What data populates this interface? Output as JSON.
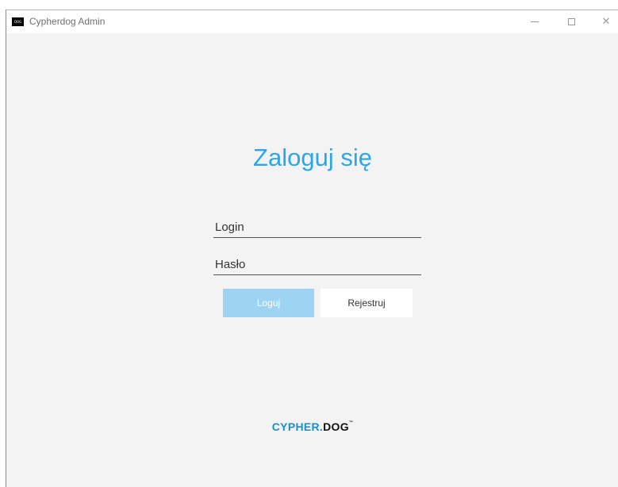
{
  "window": {
    "title": "Cypherdog Admin",
    "icon_label": "DOG",
    "controls": {
      "minimize_icon": "minimize-icon",
      "maximize_icon": "maximize-icon",
      "close_icon": "close-icon",
      "close_glyph": "✕"
    }
  },
  "login_form": {
    "heading": "Zaloguj się",
    "login_placeholder": "Login",
    "password_placeholder": "Hasło",
    "login_button": "Loguj",
    "register_button": "Rejestruj"
  },
  "brand": {
    "part1": "CYPHER.",
    "part2": "DOG",
    "mark": "™",
    "colors": {
      "accent": "#1a8fd0",
      "dark": "#111111"
    }
  },
  "colors": {
    "heading": "#2ba6e6",
    "login_button_bg": "#9dd4f4",
    "background": "#f3f3f3"
  }
}
